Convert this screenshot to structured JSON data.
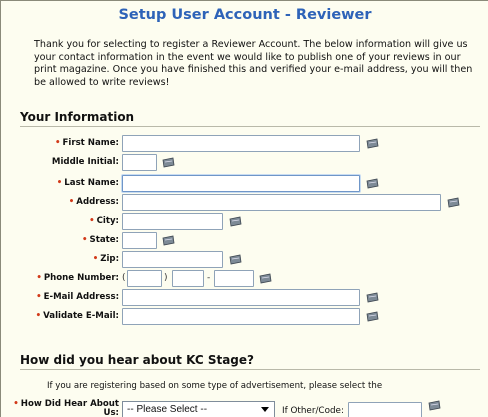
{
  "title": "Setup User Account - Reviewer",
  "intro": "Thank you for selecting to register a Reviewer Account. The below information will give us your contact information in the event we would like to publish one of your reviews in our print magazine. Once you have finished this and verified your e-mail address, you will then be allowed to write reviews!",
  "your_info": {
    "heading": "Your Information",
    "fields": {
      "first_name": "First Name:",
      "middle_initial": "Middle Initial:",
      "last_name": "Last Name:",
      "address": "Address:",
      "city": "City:",
      "state": "State:",
      "zip": "Zip:",
      "phone": "Phone Number:",
      "email": "E-Mail Address:",
      "validate_email": "Validate E-Mail:"
    },
    "phone_open": "(",
    "phone_close": ")",
    "phone_dash": "-",
    "required_mark": "•"
  },
  "hear": {
    "heading": "How did you hear about KC Stage?",
    "intro": "If you are registering based on some type of advertisement, please select the",
    "label_line1": "How Did Hear About",
    "label_line2": "Us:",
    "select_value": "-- Please Select --",
    "other_label": "If Other/Code:"
  },
  "colors": {
    "title": "#2e63b8",
    "required": "#d23a1a",
    "background": "#fdfdf0"
  }
}
